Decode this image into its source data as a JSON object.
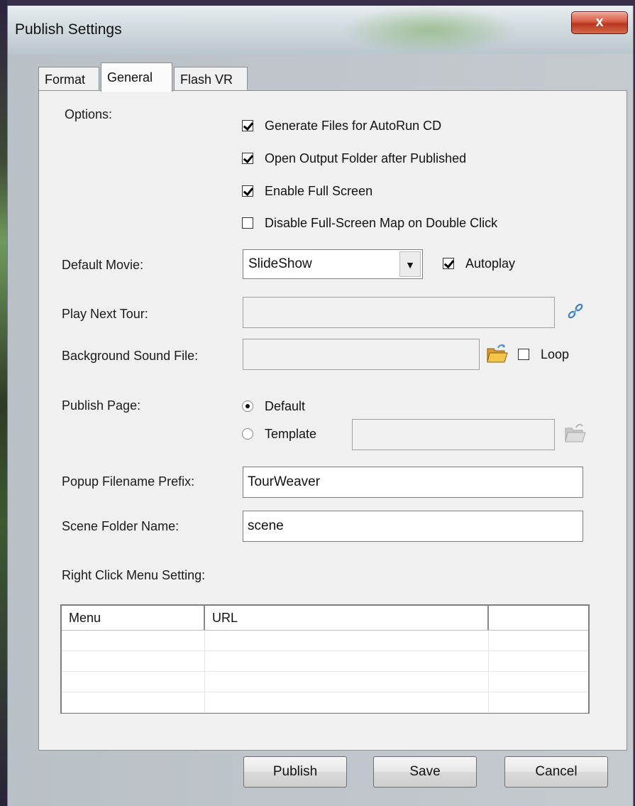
{
  "window": {
    "title": "Publish Settings",
    "close_label": "x"
  },
  "tabs": [
    {
      "label": "Format",
      "active": false
    },
    {
      "label": "General",
      "active": true
    },
    {
      "label": "Flash VR",
      "active": false
    }
  ],
  "options": {
    "label": "Options:",
    "items": [
      {
        "label": "Generate Files for AutoRun CD",
        "checked": true
      },
      {
        "label": "Open Output Folder after Published",
        "checked": true
      },
      {
        "label": "Enable Full Screen",
        "checked": true
      },
      {
        "label": "Disable Full-Screen Map on Double Click",
        "checked": false
      }
    ]
  },
  "default_movie": {
    "label": "Default Movie:",
    "value": "SlideShow",
    "autoplay_label": "Autoplay",
    "autoplay_checked": true
  },
  "play_next_tour": {
    "label": "Play Next Tour:",
    "value": ""
  },
  "background_sound": {
    "label": "Background Sound File:",
    "value": "",
    "loop_label": "Loop",
    "loop_checked": false
  },
  "publish_page": {
    "label": "Publish Page:",
    "default_label": "Default",
    "template_label": "Template",
    "selected": "Default",
    "template_value": ""
  },
  "popup_prefix": {
    "label": "Popup Filename Prefix:",
    "value": "TourWeaver"
  },
  "scene_folder": {
    "label": "Scene Folder Name:",
    "value": "scene"
  },
  "right_click_menu": {
    "label": "Right Click Menu Setting:",
    "columns": [
      "Menu",
      "URL",
      ""
    ],
    "rows": [
      [
        "",
        "",
        ""
      ],
      [
        "",
        "",
        ""
      ],
      [
        "",
        "",
        ""
      ],
      [
        "",
        "",
        ""
      ]
    ]
  },
  "buttons": {
    "publish": "Publish",
    "save": "Save",
    "cancel": "Cancel"
  },
  "colors": {
    "close_red": "#c8462d",
    "panel_bg": "#f0f0f0",
    "folder_yellow": "#e8b53a"
  }
}
